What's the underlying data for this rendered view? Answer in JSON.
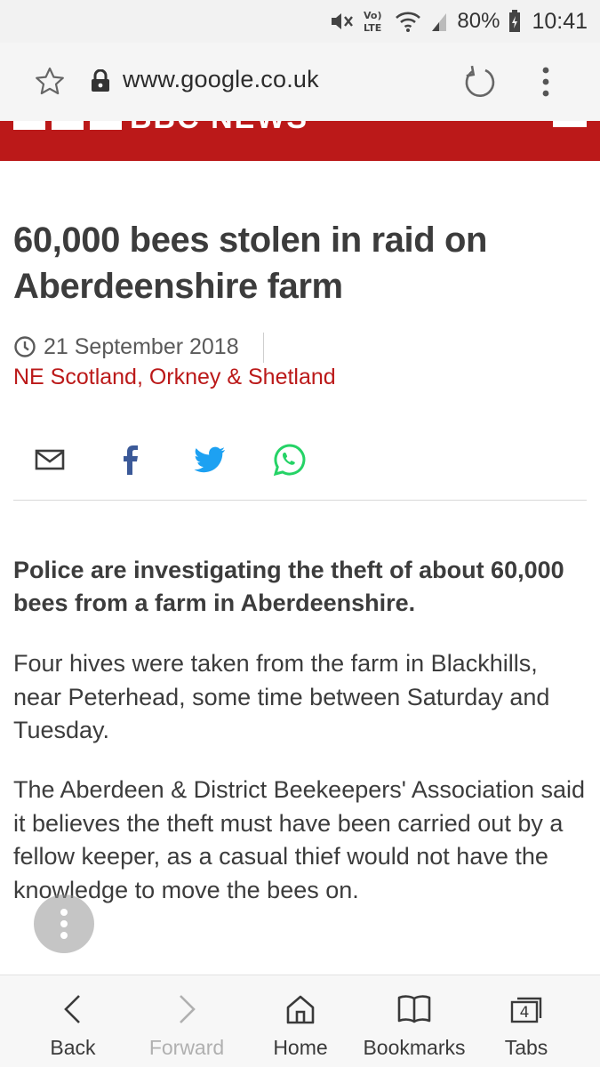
{
  "status_bar": {
    "battery": "80%",
    "time": "10:41",
    "icons": [
      "mute-icon",
      "volte-icon",
      "wifi-icon",
      "signal-icon",
      "battery-icon"
    ]
  },
  "url_bar": {
    "url": "www.google.co.uk",
    "icons": [
      "star-icon",
      "lock-icon",
      "reload-icon",
      "more-icon"
    ]
  },
  "site": {
    "brand": "BBC NEWS",
    "brand_color": "#bb1919"
  },
  "article": {
    "headline": "60,000 bees stolen in raid on Aberdeenshire farm",
    "date": "21 September 2018",
    "section": "NE Scotland, Orkney & Shetland",
    "share": [
      "email-icon",
      "facebook-icon",
      "twitter-icon",
      "whatsapp-icon"
    ],
    "intro": "Police are investigating the theft of about 60,000 bees from a farm in Aberdeenshire.",
    "paragraphs": [
      "Four hives were taken from the farm in Blackhills, near Peterhead, some time between Saturday and Tuesday.",
      "The Aberdeen & District Beekeepers' Association said it believes the theft must have been carried out by a fellow keeper, as a casual thief would not have the knowledge to move the bees on."
    ]
  },
  "bottom_nav": {
    "back": "Back",
    "forward": "Forward",
    "home": "Home",
    "bookmarks": "Bookmarks",
    "tabs": "Tabs",
    "tab_count": "4"
  },
  "colors": {
    "twitter": "#1da1f2",
    "facebook": "#3b5998",
    "whatsapp": "#25d366",
    "section_link": "#bb1919"
  }
}
